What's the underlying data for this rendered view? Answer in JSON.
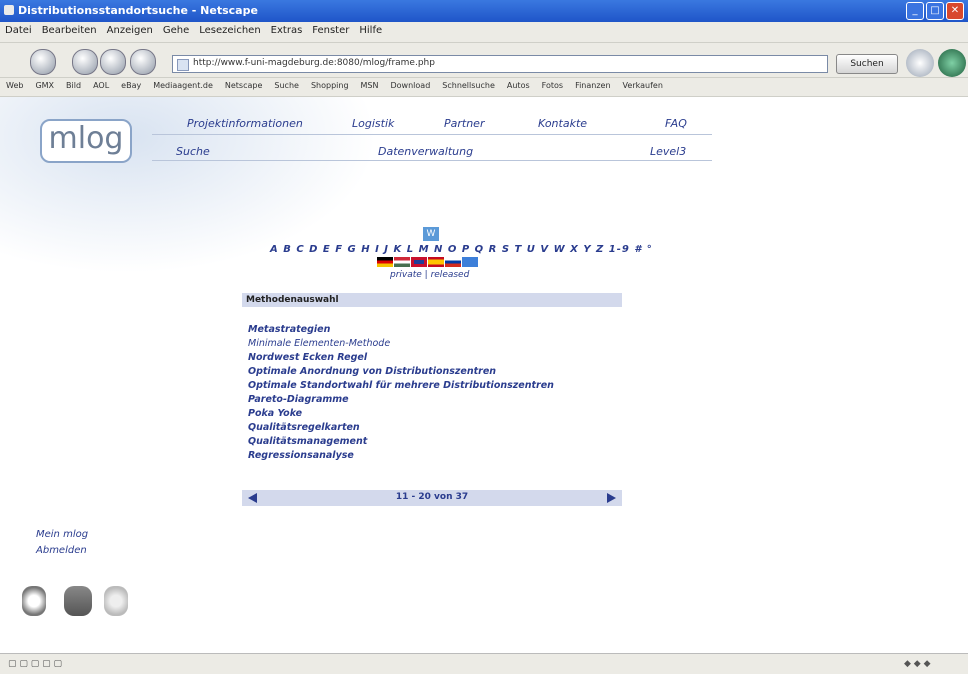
{
  "window": {
    "title": "Distributionsstandortsuche - Netscape"
  },
  "menu": [
    "Datei",
    "Bearbeiten",
    "Anzeigen",
    "Gehe",
    "Lesezeichen",
    "Extras",
    "Fenster",
    "Hilfe"
  ],
  "toolbar": {
    "url": "http://www.f-uni-magdeburg.de:8080/mlog/frame.php",
    "search_label": "Suchen"
  },
  "bookmarks": [
    "Web",
    "GMX",
    "Bild",
    "AOL",
    "eBay",
    "Mediaagent.de",
    "Netscape",
    "Suche",
    "Shopping",
    "MSN",
    "Download",
    "Schnellsuche",
    "Autos",
    "Fotos",
    "Finanzen",
    "Verkaufen"
  ],
  "site": {
    "logo": "mlog",
    "nav_row1": [
      "Projektinformationen",
      "Logistik",
      "Partner",
      "Kontakte",
      "FAQ"
    ],
    "nav_row2": [
      "Suche",
      "Datenverwaltung",
      "Level3"
    ],
    "w_button": "W",
    "alphabet": "A B C D E F G H I J K L M N O P Q R S T U V W X Y Z 1-9 # °",
    "private_public": "private | released",
    "section_title": "Methodenauswahl",
    "methods": [
      "Metastrategien",
      "Minimale Elementen-Methode",
      "Nordwest Ecken Regel",
      "Optimale Anordnung von Distributionszentren",
      "Optimale Standortwahl für mehrere Distributionszentren",
      "Pareto-Diagramme",
      "Poka Yoke",
      "Qualitätsregelkarten",
      "Qualitätsmanagement",
      "Regressionsanalyse"
    ],
    "pager_text": "11 - 20 von 37",
    "side_links": [
      "Mein mlog",
      "Abmelden"
    ]
  },
  "flags": [
    {
      "name": "german-flag",
      "color": "#cc0000"
    },
    {
      "name": "hungarian-flag",
      "color": "#2e8b3a"
    },
    {
      "name": "uk-flag",
      "color": "#1f3f9a"
    },
    {
      "name": "spanish-flag",
      "color": "#e5b000"
    },
    {
      "name": "russian-flag",
      "color": "#2244bb"
    },
    {
      "name": "eu-flag",
      "color": "#3d7fd9"
    }
  ],
  "colors": {
    "accent": "#2a3c8e",
    "titlebar": "#2a5fd0"
  }
}
